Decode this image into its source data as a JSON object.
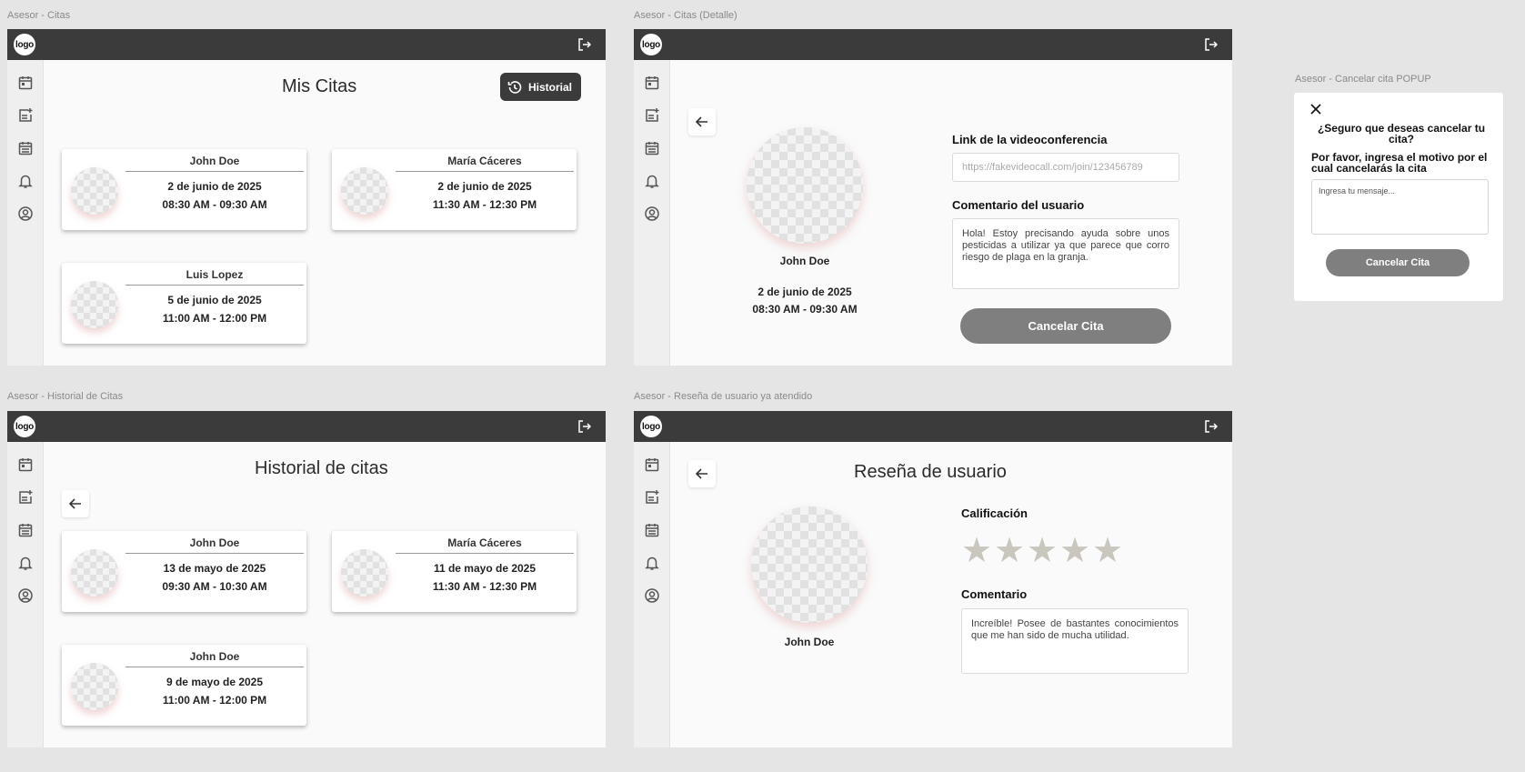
{
  "frames": {
    "citas": {
      "label": "Asesor - Citas"
    },
    "detalle": {
      "label": "Asesor - Citas (Detalle)"
    },
    "popup": {
      "label": "Asesor - Cancelar cita POPUP"
    },
    "historial": {
      "label": "Asesor - Historial de Citas"
    },
    "resena": {
      "label": "Asesor - Reseña de usuario ya atendido"
    }
  },
  "common": {
    "logo": "logo",
    "sidebar_icons": [
      "calendar-icon",
      "add-note-icon",
      "calendar-grid-icon",
      "bell-icon",
      "user-circle-icon"
    ]
  },
  "citas": {
    "title": "Mis Citas",
    "historial_button": "Historial",
    "cards": [
      {
        "name": "John Doe",
        "date": "2 de junio de 2025",
        "time": "08:30 AM - 09:30 AM"
      },
      {
        "name": "María Cáceres",
        "date": "2 de junio de 2025",
        "time": "11:30 AM - 12:30 PM"
      },
      {
        "name": "Luis Lopez",
        "date": "5 de junio de 2025",
        "time": "11:00 AM - 12:00 PM"
      }
    ]
  },
  "detalle": {
    "user_name": "John Doe",
    "date": "2 de junio de 2025",
    "time": "08:30 AM - 09:30 AM",
    "link_label": "Link de la videoconferencia",
    "link_value": "https://fakevideocall.com/join/123456789",
    "comment_label": "Comentario del usuario",
    "comment_text": "Hola! Estoy precisando ayuda sobre unos pesticidas a utilizar ya que parece que corro riesgo de plaga en la granja.",
    "cancel_button": "Cancelar Cita"
  },
  "popup": {
    "title": "¿Seguro que deseas cancelar tu cita?",
    "subtitle": "Por favor, ingresa el motivo por el cual cancelarás la cita",
    "placeholder": "Ingresa tu mensaje...",
    "button": "Cancelar Cita"
  },
  "historial": {
    "title": "Historial de citas",
    "cards": [
      {
        "name": "John Doe",
        "date": "13 de mayo de 2025",
        "time": "09:30 AM - 10:30 AM"
      },
      {
        "name": "María Cáceres",
        "date": "11 de mayo de 2025",
        "time": "11:30 AM - 12:30 PM"
      },
      {
        "name": "John Doe",
        "date": "9 de mayo de 2025",
        "time": "11:00 AM - 12:00 PM"
      }
    ]
  },
  "resena": {
    "title": "Reseña de usuario",
    "user_name": "John Doe",
    "rating_label": "Calificación",
    "rating": 0,
    "rating_max": 5,
    "comment_label": "Comentario",
    "comment_text": "Increíble! Posee de bastantes conocimientos que me han sido de mucha utilidad."
  },
  "colors": {
    "topbar": "#3b3b3b",
    "button_gray": "#7f7f7f",
    "star_empty": "#c9c7bd"
  }
}
